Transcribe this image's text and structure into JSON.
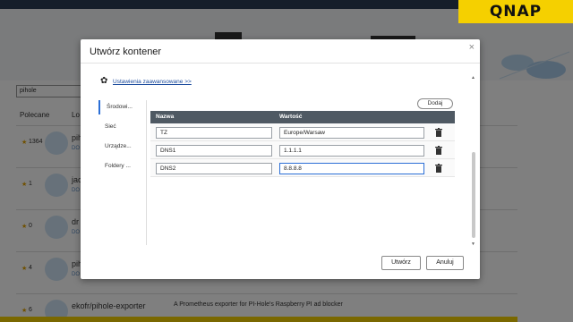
{
  "brand": {
    "logo_text": "QNAP"
  },
  "background": {
    "search_value": "pihole",
    "col_recommended": "Polecane",
    "col_local": "Lo",
    "rows": [
      {
        "count": "1364",
        "name": "pih",
        "tag": "DO"
      },
      {
        "count": "1",
        "name": "jac",
        "tag": "DO"
      },
      {
        "count": "0",
        "name": "dr",
        "tag": "DO"
      },
      {
        "count": "4",
        "name": "pih",
        "tag": "DO"
      },
      {
        "count": "6",
        "name": "ekofr/pihole-exporter",
        "tag": "",
        "desc": "A Prometheus exporter for PI-Hole's Raspberry PI ad blocker"
      }
    ]
  },
  "dialog": {
    "title": "Utwórz kontener",
    "close_icon": "×",
    "advanced_link": "Ustawienia zaawansowane >>",
    "tabs": [
      {
        "label": "Środowi..."
      },
      {
        "label": "Sieć"
      },
      {
        "label": "Urządze..."
      },
      {
        "label": "Foldery ..."
      }
    ],
    "add_button": "Dodaj",
    "table": {
      "col_name": "Nazwa",
      "col_value": "Wartość",
      "rows": [
        {
          "name": "TZ",
          "value": "Europe/Warsaw"
        },
        {
          "name": "DNS1",
          "value": "1.1.1.1"
        },
        {
          "name": "DNS2",
          "value": "8.8.8.8"
        }
      ]
    },
    "create_button": "Utwórz",
    "cancel_button": "Anuluj"
  },
  "colors": {
    "accent": "#2b6fd6",
    "brand_yellow": "#f5d000",
    "table_header": "#4f5963"
  }
}
